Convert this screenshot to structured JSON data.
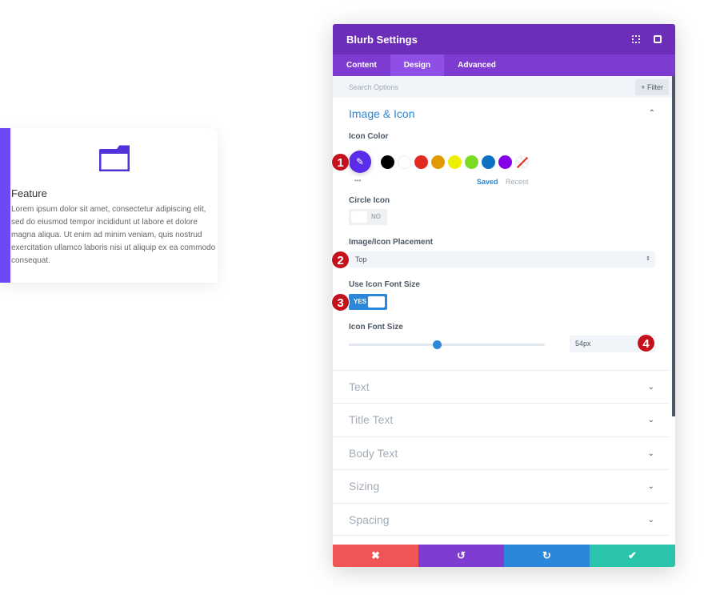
{
  "preview": {
    "title": "Feature",
    "body": "Lorem ipsum dolor sit amet, consectetur adipiscing elit, sed do eiusmod tempor incididunt ut labore et dolore magna aliqua. Ut enim ad minim veniam, quis nostrud exercitation ullamco laboris nisi ut aliquip ex ea commodo consequat.",
    "icon": "folder-icon",
    "accent": "#7047f5"
  },
  "panel": {
    "title": "Blurb Settings",
    "tabs": [
      {
        "label": "Content"
      },
      {
        "label": "Design"
      },
      {
        "label": "Advanced"
      }
    ],
    "search_placeholder": "Search Options",
    "filter_label": "+ Filter",
    "section": {
      "title": "Image & Icon",
      "icon_color_label": "Icon Color",
      "selected_color": "#5b2de8",
      "swatches": [
        "#000000",
        "#ffffff",
        "#e02b20",
        "#e09900",
        "#edf000",
        "#7cda24",
        "#0c71c3",
        "#8300e9"
      ],
      "saved": "Saved",
      "recent": "Recent",
      "more": "•••",
      "circle_icon_label": "Circle Icon",
      "circle_icon_value": "NO",
      "placement_label": "Image/Icon Placement",
      "placement_value": "Top",
      "use_font_size_label": "Use Icon Font Size",
      "use_font_size_value": "YES",
      "font_size_label": "Icon Font Size",
      "font_size_value": "54px",
      "font_size_slider_percent": 45
    },
    "collapsed": [
      {
        "label": "Text"
      },
      {
        "label": "Title Text"
      },
      {
        "label": "Body Text"
      },
      {
        "label": "Sizing"
      },
      {
        "label": "Spacing"
      }
    ],
    "footer": {
      "cancel": "✖",
      "undo": "↺",
      "redo": "↻",
      "save": "✔"
    }
  },
  "badges": [
    "1",
    "2",
    "3",
    "4"
  ]
}
